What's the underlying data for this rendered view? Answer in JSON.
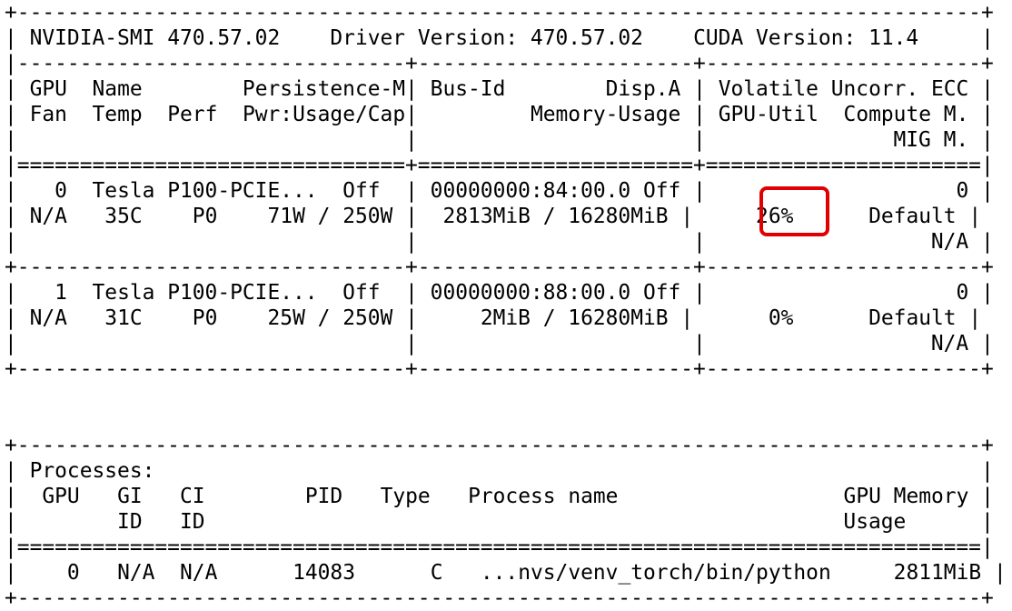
{
  "app": {
    "name": "nvidia-smi",
    "highlight_color": "#e00000"
  },
  "header": {
    "smi_label": "NVIDIA-SMI",
    "smi_version": "470.57.02",
    "driver_label": "Driver Version:",
    "driver_version": "470.57.02",
    "cuda_label": "CUDA Version:",
    "cuda_version": "11.4"
  },
  "gpu_table": {
    "headers": {
      "row1": {
        "gpu": "GPU",
        "name": "Name",
        "persistence": "Persistence-M",
        "bus_id": "Bus-Id",
        "disp_a": "Disp.A",
        "volatile": "Volatile Uncorr. ECC"
      },
      "row2": {
        "fan": "Fan",
        "temp": "Temp",
        "perf": "Perf",
        "pwr": "Pwr:Usage/Cap",
        "memory_usage": "Memory-Usage",
        "gpu_util": "GPU-Util",
        "compute_m": "Compute M."
      },
      "row3": {
        "mig_m": "MIG M."
      }
    },
    "gpus": [
      {
        "index": "0",
        "name": "Tesla P100-PCIE...",
        "persistence": "Off",
        "bus_id": "00000000:84:00.0",
        "disp_a": "Off",
        "ecc": "0",
        "fan": "N/A",
        "temp": "35C",
        "perf": "P0",
        "pwr": "71W / 250W",
        "memory_usage": "2813MiB / 16280MiB",
        "gpu_util": "26%",
        "compute_m": "Default",
        "mig_m": "N/A"
      },
      {
        "index": "1",
        "name": "Tesla P100-PCIE...",
        "persistence": "Off",
        "bus_id": "00000000:88:00.0",
        "disp_a": "Off",
        "ecc": "0",
        "fan": "N/A",
        "temp": "31C",
        "perf": "P0",
        "pwr": "25W / 250W",
        "memory_usage": "2MiB / 16280MiB",
        "gpu_util": "0%",
        "compute_m": "Default",
        "mig_m": "N/A"
      }
    ]
  },
  "processes": {
    "title": "Processes:",
    "headers": {
      "row1": {
        "gpu": "GPU",
        "gi": "GI",
        "ci": "CI",
        "pid": "PID",
        "type": "Type",
        "process_name": "Process name",
        "gpu_memory": "GPU Memory"
      },
      "row2": {
        "gi": "ID",
        "ci": "ID",
        "usage": "Usage"
      }
    },
    "rows": [
      {
        "gpu": "0",
        "gi": "N/A",
        "ci": "N/A",
        "pid": "14083",
        "type": "C",
        "name": "...nvs/venv_torch/bin/python",
        "memory": "2811MiB"
      }
    ]
  }
}
